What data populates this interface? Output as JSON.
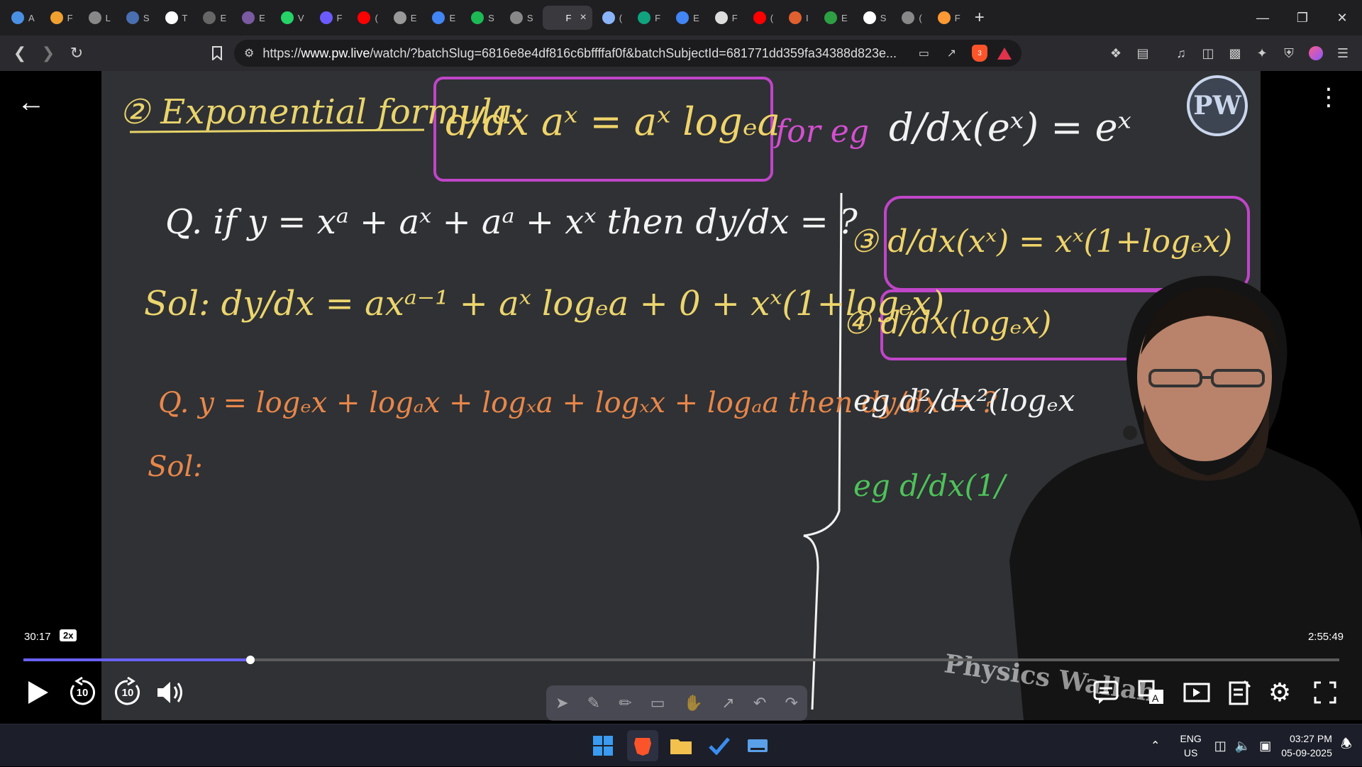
{
  "browser": {
    "tabs": [
      {
        "initial": "A",
        "color": "#4a90e2"
      },
      {
        "initial": "F",
        "color": "#f0a030"
      },
      {
        "initial": "L",
        "color": "#888888"
      },
      {
        "initial": "S",
        "color": "#4a6fb0"
      },
      {
        "initial": "T",
        "color": "#ffffff"
      },
      {
        "initial": "E",
        "color": "#666666"
      },
      {
        "initial": "E",
        "color": "#7a5aa0"
      },
      {
        "initial": "V",
        "color": "#25d366"
      },
      {
        "initial": "F",
        "color": "#6b5bff"
      },
      {
        "initial": "(",
        "color": "#ff0000"
      },
      {
        "initial": "E",
        "color": "#999999"
      },
      {
        "initial": "E",
        "color": "#4285f4"
      },
      {
        "initial": "S",
        "color": "#1db954"
      },
      {
        "initial": "S",
        "color": "#888888"
      },
      {
        "initial": "F",
        "color": "#3a3a3e",
        "active": true
      },
      {
        "initial": "(",
        "color": "#8ab4f8"
      },
      {
        "initial": "F",
        "color": "#10a37f"
      },
      {
        "initial": "E",
        "color": "#4285f4"
      },
      {
        "initial": "F",
        "color": "#dddddd"
      },
      {
        "initial": "(",
        "color": "#ff0000"
      },
      {
        "initial": "I",
        "color": "#e06030"
      },
      {
        "initial": "E",
        "color": "#2ea043"
      },
      {
        "initial": "S",
        "color": "#ffffff"
      },
      {
        "initial": "(",
        "color": "#888888"
      },
      {
        "initial": "F",
        "color": "#ff9933"
      }
    ],
    "url_prefix": "https://",
    "url_domain": "www.pw.live",
    "url_rest": "/watch/?batchSlug=6816e8e4df816c6bffffaf0f&batchSubjectId=681771dd359fa34388d823e...",
    "shields_count": "3"
  },
  "board": {
    "line1_left": "② Exponential formula:",
    "line1_formula": "d/dx aˣ = aˣ logₑa",
    "line1_foreg": "for eg",
    "line1_right": "d/dx(eˣ) = eˣ",
    "q1": "Q. if y = xᵃ + aˣ + aᵃ + xˣ then dy/dx = ?",
    "sol1": "Sol: dy/dx = axᵃ⁻¹ + aˣ logₑa + 0 + xˣ(1+logₑx)",
    "q2": "Q. y = logₑx + logₐx + logₓa + logₓx + logₐa then dy/dx = ?",
    "sol2": "Sol:",
    "r3": "③ d/dx(xˣ) = xˣ(1+logₑx)",
    "r4": "④ d/dx(logₑx)",
    "r5": "eg d²/dx²(logₑx",
    "r6": "eg d/dx(1/"
  },
  "player": {
    "current_time": "30:17",
    "speed": "2x",
    "total_time": "2:55:49",
    "progress": 0.1724,
    "rewind_label": "10",
    "forward_label": "10",
    "watermark": "Physics Wallah"
  },
  "taskbar": {
    "lang_1": "ENG",
    "lang_2": "US",
    "time": "03:27 PM",
    "date": "05-09-2025"
  }
}
